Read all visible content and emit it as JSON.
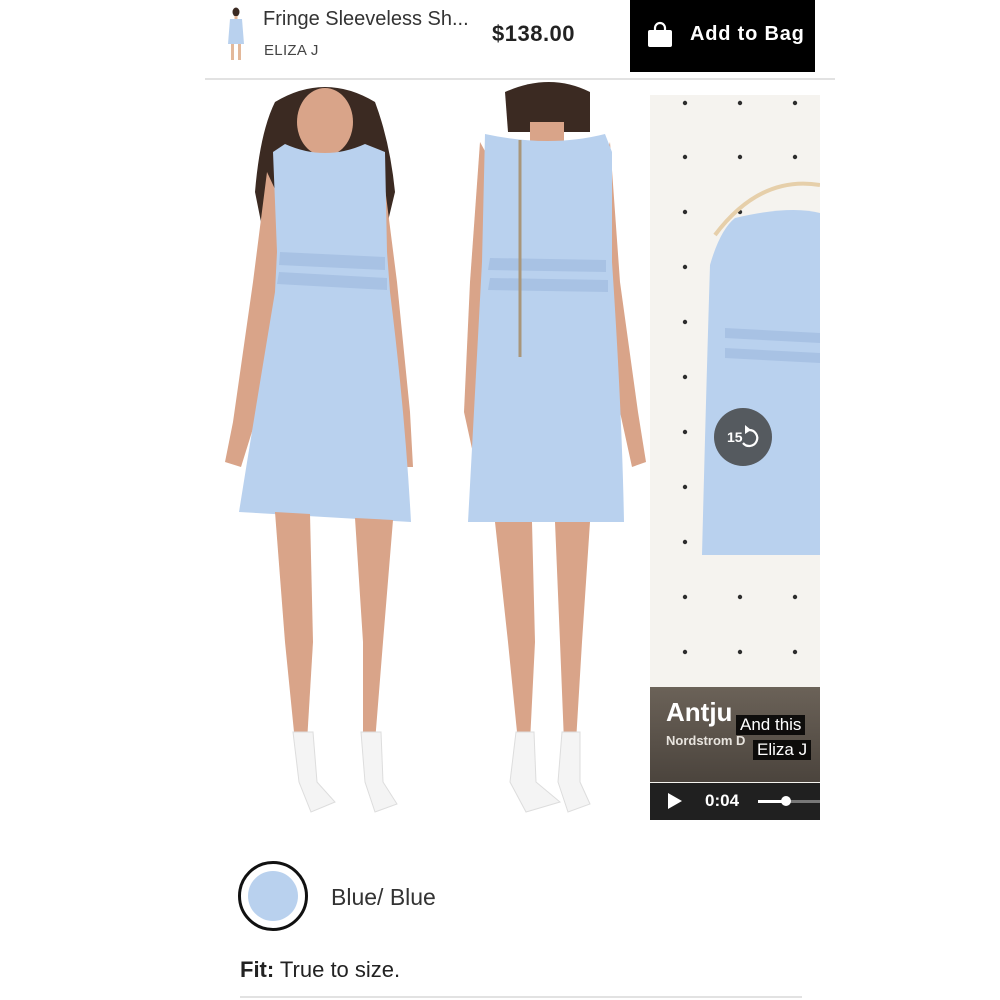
{
  "header": {
    "product_title": "Fringe Sleeveless Sh...",
    "brand": "ELIZA J",
    "price": "$138.00",
    "add_to_bag_label": "Add to Bag",
    "bag_icon": "shopping-bag-icon"
  },
  "video": {
    "replay_seconds": "15",
    "overlay_name": "Antju",
    "overlay_sub": "Nordstrom D",
    "caption_line_1": "And this",
    "caption_line_2": "Eliza J",
    "time": "0:04",
    "progress": 0.45
  },
  "product": {
    "color_name": "Blue/ Blue",
    "swatch_color": "#b9d1ee",
    "fit_label": "Fit:",
    "fit_value": " True to size."
  },
  "colors": {
    "dress": "#b9d1ee",
    "accent_button": "#000000"
  }
}
